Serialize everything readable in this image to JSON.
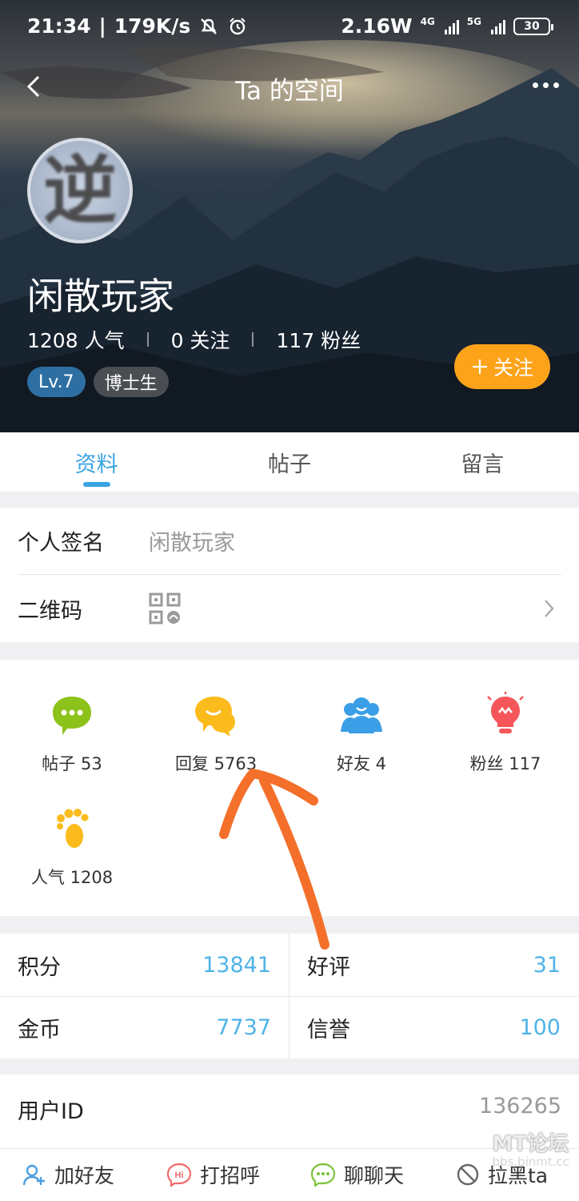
{
  "statusbar": {
    "time": "21:34",
    "speed": "179K/s",
    "power": "2.16W",
    "net1": "4G",
    "net2": "5G",
    "battery": "30"
  },
  "nav": {
    "title": "Ta 的空间"
  },
  "profile": {
    "avatar_char": "逆",
    "name": "闲散玩家",
    "popularity": "1208 人气",
    "following": "0 关注",
    "fans": "117 粉丝",
    "level": "Lv.7",
    "title_badge": "博士生",
    "follow_label": "关注"
  },
  "tabs": [
    {
      "label": "资料"
    },
    {
      "label": "帖子"
    },
    {
      "label": "留言"
    }
  ],
  "info": {
    "signature_label": "个人签名",
    "signature_value": "闲散玩家",
    "qr_label": "二维码"
  },
  "activity": [
    {
      "label": "帖子 53",
      "icon": "chat-bubble-icon",
      "color": "#8cc21a"
    },
    {
      "label": "回复 5763",
      "icon": "reply-bubble-icon",
      "color": "#fbbb1c"
    },
    {
      "label": "好友 4",
      "icon": "friends-icon",
      "color": "#3a9fe6"
    },
    {
      "label": "粉丝 117",
      "icon": "lightbulb-icon",
      "color": "#f5565a"
    },
    {
      "label": "人气 1208",
      "icon": "footprint-icon",
      "color": "#fbbb1c"
    }
  ],
  "scores": {
    "points_label": "积分",
    "points_value": "13841",
    "rating_label": "好评",
    "rating_value": "31",
    "coins_label": "金币",
    "coins_value": "7737",
    "credit_label": "信誉",
    "credit_value": "100"
  },
  "user": {
    "id_label": "用户ID",
    "id_value": "136265"
  },
  "bottom_bar": {
    "add_friend": "加好友",
    "greet": "打招呼",
    "chat": "聊聊天",
    "block": "拉黑ta"
  },
  "watermark": {
    "main": "MT论坛",
    "sub": "bbs.binmt.cc"
  },
  "colors": {
    "accent": "#3aa3e3",
    "follow": "#fda31a",
    "value_blue": "#4fb3e8",
    "annotation": "#f36f2a"
  }
}
